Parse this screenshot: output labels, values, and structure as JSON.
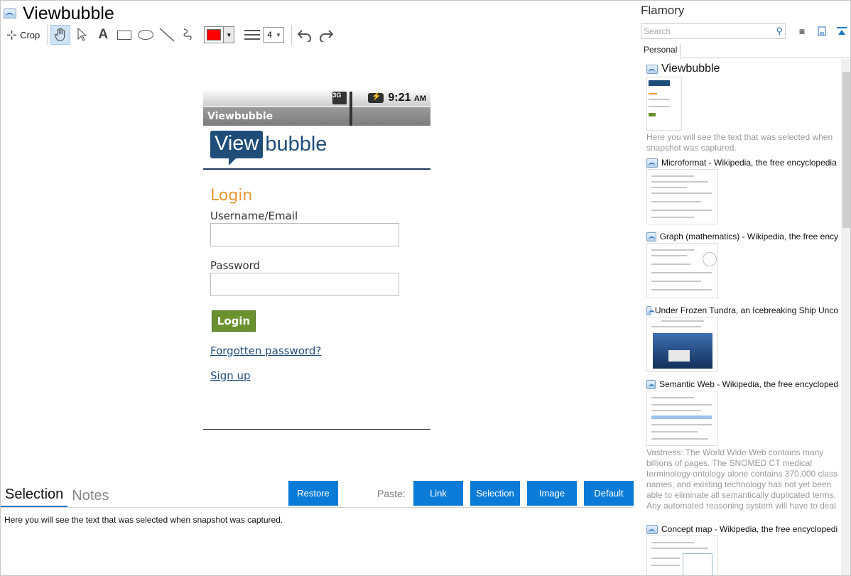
{
  "window": {
    "title": "Viewbubble"
  },
  "toolbar": {
    "crop_label": "Crop",
    "tools": [
      "hand-icon",
      "pointer-icon",
      "text-icon",
      "rectangle-icon",
      "ellipse-icon",
      "line-icon",
      "freehand-icon"
    ],
    "color": "#ff0000",
    "line_width": "4"
  },
  "phone": {
    "time": "9:21",
    "ampm": "AM",
    "appbar_title": "Viewbubble",
    "logo_box": "View",
    "logo_rest": "bubble",
    "login_heading": "Login",
    "username_label": "Username/Email",
    "password_label": "Password",
    "login_button": "Login",
    "forgot_link": "Forgotten password?",
    "signup_link": "Sign up"
  },
  "bottom": {
    "tabs": [
      "Selection",
      "Notes"
    ],
    "restore_button": "Restore",
    "paste_label": "Paste:",
    "paste_buttons": [
      "Link",
      "Selection",
      "Image",
      "Default"
    ],
    "selection_text": "Here you will see the text that was selected when snapshot was captured."
  },
  "side": {
    "title": "Flamory",
    "search_placeholder": "Search",
    "tab": "Personal",
    "items": [
      {
        "title": "Viewbubble",
        "desc": "Here you will see the text that was selected when snapshot was captured."
      },
      {
        "title": "Microformat - Wikipedia, the free encyclopedia",
        "desc": ""
      },
      {
        "title": "Graph (mathematics) - Wikipedia, the free ency",
        "desc": ""
      },
      {
        "title": "Under Frozen Tundra, an Icebreaking Ship Unco",
        "desc": ""
      },
      {
        "title": "Semantic Web - Wikipedia, the free encycloped",
        "desc": "Vastness: The World Wide Web contains many billions of pages. The SNOMED CT medical terminology ontology alone contains 370,000 class names, and existing technology has not yet been able to eliminate all semantically duplicated terms. Any automated reasoning system will have to deal with truly huge inputs."
      },
      {
        "title": "Concept map - Wikipedia, the free encyclopedi",
        "desc": ""
      }
    ]
  },
  "colors": {
    "accent": "#0a7bd6",
    "brand": "#1f4d7a",
    "login_orange": "#e8962f",
    "login_green": "#69922f"
  }
}
